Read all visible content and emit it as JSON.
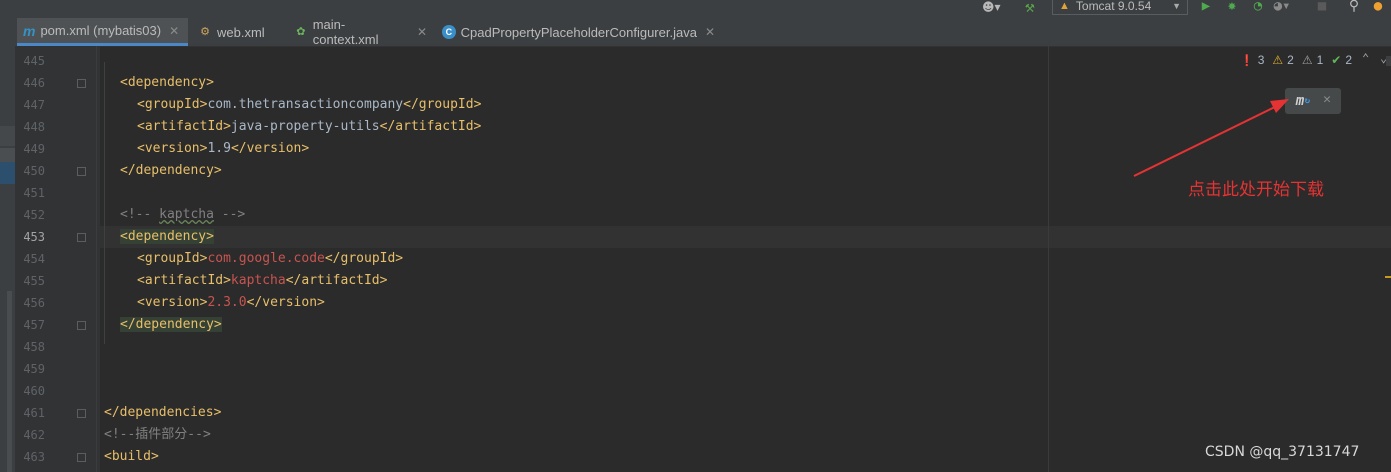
{
  "toolbar": {
    "user_icon": "user-icon",
    "build_icon": "hammer-icon",
    "run_config": "Tomcat 9.0.54",
    "run_icon": "run-icon",
    "debug_icon": "debug-icon",
    "coverage_icon": "coverage-icon",
    "profile_icon": "profile-icon",
    "stop_icon": "stop-icon",
    "search_icon": "search-icon",
    "update_icon": "update-icon"
  },
  "tabs": [
    {
      "label": "pom.xml (mybatis03)",
      "icon": "maven-icon",
      "active": true
    },
    {
      "label": "web.xml",
      "icon": "xml-file-icon",
      "active": false
    },
    {
      "label": "main-context.xml",
      "icon": "spring-xml-icon",
      "active": false
    },
    {
      "label": "CpadPropertyPlaceholderConfigurer.java",
      "icon": "java-class-icon",
      "active": false
    }
  ],
  "inspections": {
    "errors": "3",
    "warnings": "2",
    "weak_warnings": "1",
    "typos": "2"
  },
  "editor": {
    "lines": [
      {
        "num": "445",
        "segments": []
      },
      {
        "num": "446",
        "segments": [
          {
            "t": "<dependency>",
            "c": "tag"
          }
        ]
      },
      {
        "num": "447",
        "segments": [
          {
            "t": "<groupId>",
            "c": "tag"
          },
          {
            "t": "com.thetransactioncompany",
            "c": "txt"
          },
          {
            "t": "</groupId>",
            "c": "tag"
          }
        ]
      },
      {
        "num": "448",
        "segments": [
          {
            "t": "<artifactId>",
            "c": "tag"
          },
          {
            "t": "java-property-utils",
            "c": "txt"
          },
          {
            "t": "</artifactId>",
            "c": "tag"
          }
        ]
      },
      {
        "num": "449",
        "segments": [
          {
            "t": "<version>",
            "c": "tag"
          },
          {
            "t": "1.9",
            "c": "txt"
          },
          {
            "t": "</version>",
            "c": "tag"
          }
        ]
      },
      {
        "num": "450",
        "segments": [
          {
            "t": "</dependency>",
            "c": "tag"
          }
        ]
      },
      {
        "num": "451",
        "segments": []
      },
      {
        "num": "452",
        "segments": [
          {
            "t": "<!-- ",
            "c": "cmt"
          },
          {
            "t": "kaptcha",
            "c": "cmt squig"
          },
          {
            "t": " -->",
            "c": "cmt"
          }
        ]
      },
      {
        "num": "453",
        "segments": [
          {
            "t": "<dependency>",
            "c": "tag hl"
          }
        ]
      },
      {
        "num": "454",
        "segments": [
          {
            "t": "<groupId>",
            "c": "tag"
          },
          {
            "t": "com.google.code",
            "c": "str"
          },
          {
            "t": "</groupId>",
            "c": "tag"
          }
        ]
      },
      {
        "num": "455",
        "segments": [
          {
            "t": "<artifactId>",
            "c": "tag"
          },
          {
            "t": "kaptcha",
            "c": "str"
          },
          {
            "t": "</artifactId>",
            "c": "tag"
          }
        ]
      },
      {
        "num": "456",
        "segments": [
          {
            "t": "<version>",
            "c": "tag"
          },
          {
            "t": "2.3.0",
            "c": "str"
          },
          {
            "t": "</version>",
            "c": "tag"
          }
        ]
      },
      {
        "num": "457",
        "segments": [
          {
            "t": "</dependency>",
            "c": "tag hl"
          }
        ]
      },
      {
        "num": "458",
        "segments": []
      },
      {
        "num": "459",
        "segments": []
      },
      {
        "num": "460",
        "segments": []
      },
      {
        "num": "461",
        "segments": [
          {
            "t": "</dependencies>",
            "c": "tag"
          }
        ]
      },
      {
        "num": "462",
        "segments": [
          {
            "t": "<!--插件部分-->",
            "c": "cmt"
          }
        ]
      },
      {
        "num": "463",
        "segments": [
          {
            "t": "<build>",
            "c": "tag"
          }
        ]
      }
    ]
  },
  "maven_popup": {
    "load_icon": "maven-reload-icon",
    "close_icon": "close-icon"
  },
  "annotation": "点击此处开始下载",
  "watermark": "CSDN @qq_37131747",
  "colors": {
    "editor_bg": "#2b2b2b",
    "tag": "#e8bf6a",
    "text": "#a9b7c6",
    "string_red": "#c75450",
    "comment": "#808080",
    "annotation_red": "#e53333"
  }
}
